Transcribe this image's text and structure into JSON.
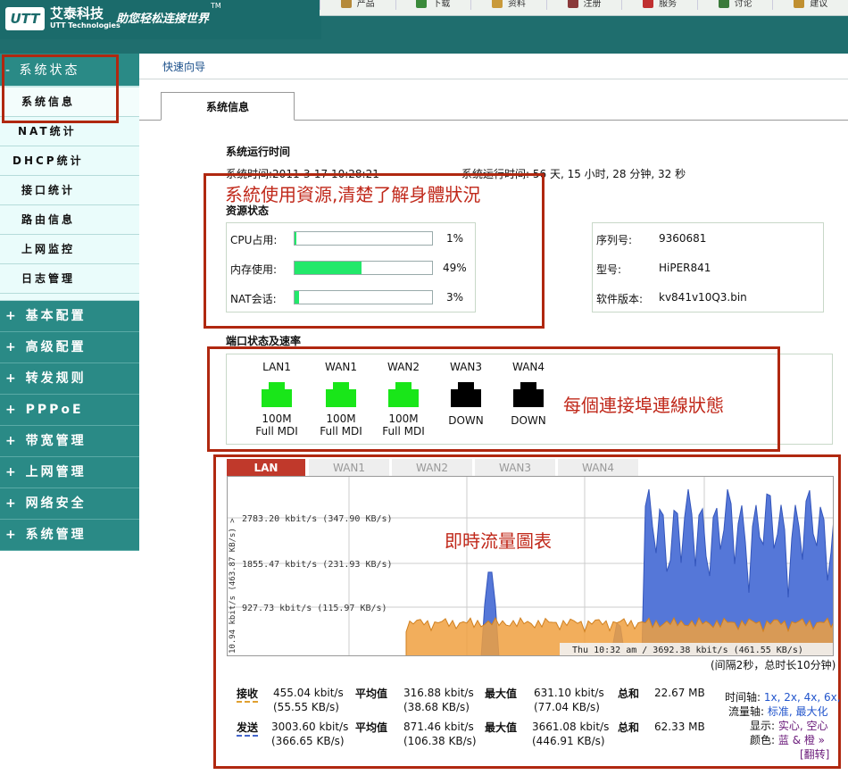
{
  "header": {
    "brand_badge": "UTT",
    "brand_cn": "艾泰科技",
    "brand_en": "UTT Technologies",
    "slogan": "助您轻松连接世界",
    "tm": "TM",
    "nav": [
      {
        "label": "产品",
        "icon": "box-icon",
        "color": "#b58a3a"
      },
      {
        "label": "下载",
        "icon": "download-icon",
        "color": "#3a8a3a"
      },
      {
        "label": "资料",
        "icon": "book-icon",
        "color": "#c99a3a"
      },
      {
        "label": "注册",
        "icon": "edit-icon",
        "color": "#8a3a3a"
      },
      {
        "label": "服务",
        "icon": "mail-icon",
        "color": "#c03030"
      },
      {
        "label": "讨论",
        "icon": "chat-icon",
        "color": "#3a7a3a"
      },
      {
        "label": "建议",
        "icon": "lightbulb-icon",
        "color": "#c09030"
      }
    ]
  },
  "sidebar": {
    "section": "- 系统状态",
    "items": [
      "系统信息",
      "NAT统计",
      "DHCP统计",
      "接口统计",
      "路由信息",
      "上网监控",
      "日志管理"
    ],
    "groups": [
      "+ 基本配置",
      "+ 高级配置",
      "+ 转发规则",
      "+ PPPoE",
      "+ 带宽管理",
      "+ 上网管理",
      "+ 网络安全",
      "+ 系统管理"
    ]
  },
  "breadcrumb": "快速向导",
  "tab": "系统信息",
  "uptime": {
    "title": "系统运行时间",
    "system_time": "系统时间:2011-3-17 10:28:21",
    "run_time": "系统运行时间: 56 天, 15 小时, 28 分钟, 32 秒"
  },
  "resource": {
    "title": "资源状态",
    "rows": [
      {
        "label": "CPU占用:",
        "percent": 1,
        "text": "1%"
      },
      {
        "label": "内存使用:",
        "percent": 49,
        "text": "49%"
      },
      {
        "label": "NAT会话:",
        "percent": 3,
        "text": "3%"
      }
    ]
  },
  "device": {
    "serial_label": "序列号:",
    "serial": "9360681",
    "model_label": "型号:",
    "model": "HiPER841",
    "fw_label": "软件版本:",
    "fw": "kv841v10Q3.bin"
  },
  "ports": {
    "title": "端口状态及速率",
    "items": [
      {
        "name": "LAN1",
        "status": "100M Full MDI",
        "up": true
      },
      {
        "name": "WAN1",
        "status": "100M Full MDI",
        "up": true
      },
      {
        "name": "WAN2",
        "status": "100M Full MDI",
        "up": true
      },
      {
        "name": "WAN3",
        "status": "DOWN",
        "up": false
      },
      {
        "name": "WAN4",
        "status": "DOWN",
        "up": false
      }
    ]
  },
  "annotations": {
    "resource": "系統使用資源,清楚了解身體狀況",
    "ports": "每個連接埠連線狀態",
    "chart": "即時流量圖表"
  },
  "chart_tabs": [
    "LAN",
    "WAN1",
    "WAN2",
    "WAN3",
    "WAN4"
  ],
  "chart_data": {
    "type": "area",
    "y_axis_label": "10.94 kbit/s (463.87 KB/s) >",
    "gridlines": [
      "2783.20 kbit/s (347.90 KB/s)",
      "1855.47 kbit/s (231.93 KB/s)",
      "927.73 kbit/s (115.97 KB/s)"
    ],
    "timestamp": "Thu 10:32 am / 3692.38 kbit/s (461.55 KB/s)",
    "interval": "(间隔2秒，总时长10分钟)",
    "series": [
      {
        "color": "#5577d8"
      },
      {
        "color": "#f0a040"
      }
    ]
  },
  "stats": {
    "rx": {
      "label": "接收",
      "value": "455.04 kbit/s",
      "value2": "(55.55 KB/s)",
      "avg_label": "平均值",
      "avg": "316.88 kbit/s",
      "avg2": "(38.68 KB/s)",
      "max_label": "最大值",
      "max": "631.10 kbit/s",
      "max2": "(77.04 KB/s)",
      "total_label": "总和",
      "total": "22.67 MB"
    },
    "tx": {
      "label": "发送",
      "value": "3003.60 kbit/s",
      "value2": "(366.65 KB/s)",
      "avg_label": "平均值",
      "avg": "871.46 kbit/s",
      "avg2": "(106.38 KB/s)",
      "max_label": "最大值",
      "max": "3661.08 kbit/s",
      "max2": "(446.91 KB/s)",
      "total_label": "总和",
      "total": "62.33 MB"
    }
  },
  "time_controls": {
    "timeaxis": "时间轴:",
    "timeaxis_opts": "1x, 2x, 4x, 6x,",
    "flowaxis": "流量轴:",
    "flowaxis_opts": "标准, 最大化",
    "display": "显示:",
    "display_opts": "实心, 空心",
    "color": "颜色:",
    "color_opts": "蓝 & 橙 »",
    "flip": "[翻转]"
  }
}
